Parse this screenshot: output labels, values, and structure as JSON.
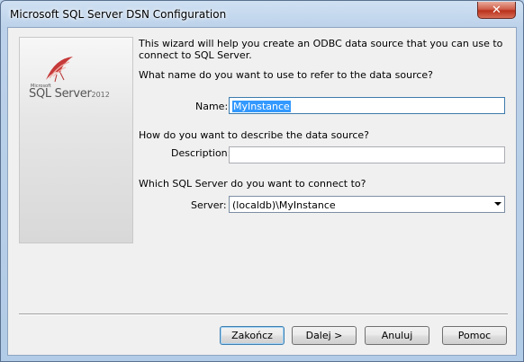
{
  "window": {
    "title": "Microsoft SQL Server DSN Configuration",
    "close_glyph": "✕"
  },
  "logo": {
    "microsoft": "Microsoft",
    "product": "SQL Server",
    "year": "2012"
  },
  "intro_text": "This wizard will help you create an ODBC data source that you can use to connect to SQL Server.",
  "name_section": {
    "question": "What name do you want to use to refer to the data source?",
    "label": "Name:",
    "value": "MyInstance"
  },
  "description_section": {
    "question": "How do you want to describe the data source?",
    "label": "Description:",
    "value": ""
  },
  "server_section": {
    "question": "Which SQL Server do you want to connect to?",
    "label": "Server:",
    "value": "(localdb)\\MyInstance"
  },
  "buttons": {
    "finish": "Zakończ",
    "next": "Dalej >",
    "cancel": "Anuluj",
    "help": "Pomoc"
  }
}
